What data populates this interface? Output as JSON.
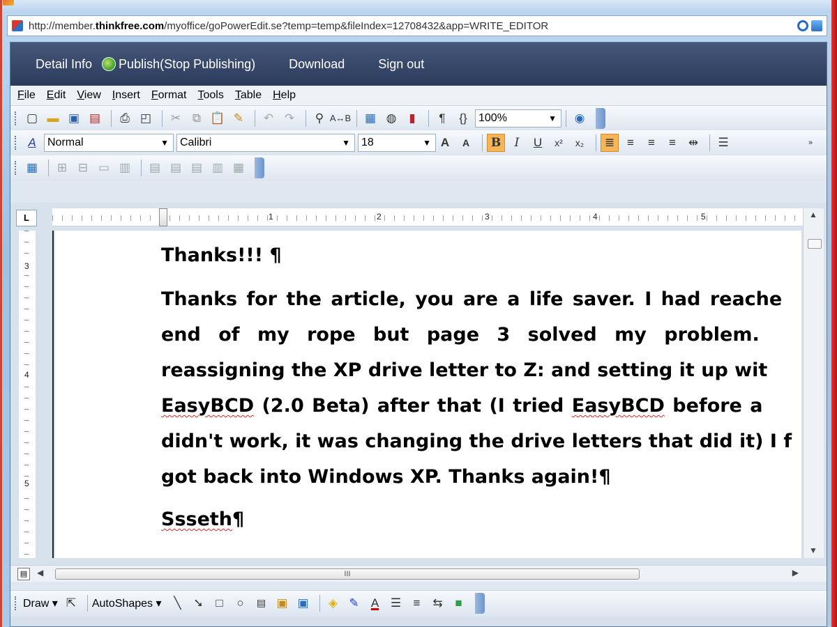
{
  "browser": {
    "url_prefix": "http://member.",
    "url_domain": "thinkfree.com",
    "url_rest": "/myoffice/goPowerEdit.se?temp=temp&fileIndex=12708432&app=WRITE_EDITOR"
  },
  "topnav": {
    "detail": "Detail Info",
    "publish": "Publish(Stop Publishing)",
    "download": "Download",
    "signout": "Sign out"
  },
  "menus": [
    "File",
    "Edit",
    "View",
    "Insert",
    "Format",
    "Tools",
    "Table",
    "Help"
  ],
  "toolbar": {
    "zoom": "100%",
    "style": "Normal",
    "font": "Calibri",
    "size": "18"
  },
  "ruler": {
    "h_numbers": [
      "1",
      "2",
      "3",
      "4",
      "5"
    ],
    "v_numbers": [
      "3",
      "4",
      "5"
    ]
  },
  "document": {
    "p1": "Thanks!!! ¶",
    "p2_lines": [
      "Thanks for the article, you are a life saver. I had reache",
      "end of my rope but page 3 solved my problem.",
      "reassigning the XP drive letter to Z: and setting it up wit",
      "EasyBCD (2.0 Beta) after that (I tried EasyBCD before a",
      "didn't work, it was changing the drive letters that did it) I f",
      "got back into Windows XP. Thanks again!¶"
    ],
    "p3": "Ssseth¶"
  },
  "drawbar": {
    "draw": "Draw",
    "autoshapes": "AutoShapes"
  },
  "scroll": {
    "hthumb": "III"
  }
}
